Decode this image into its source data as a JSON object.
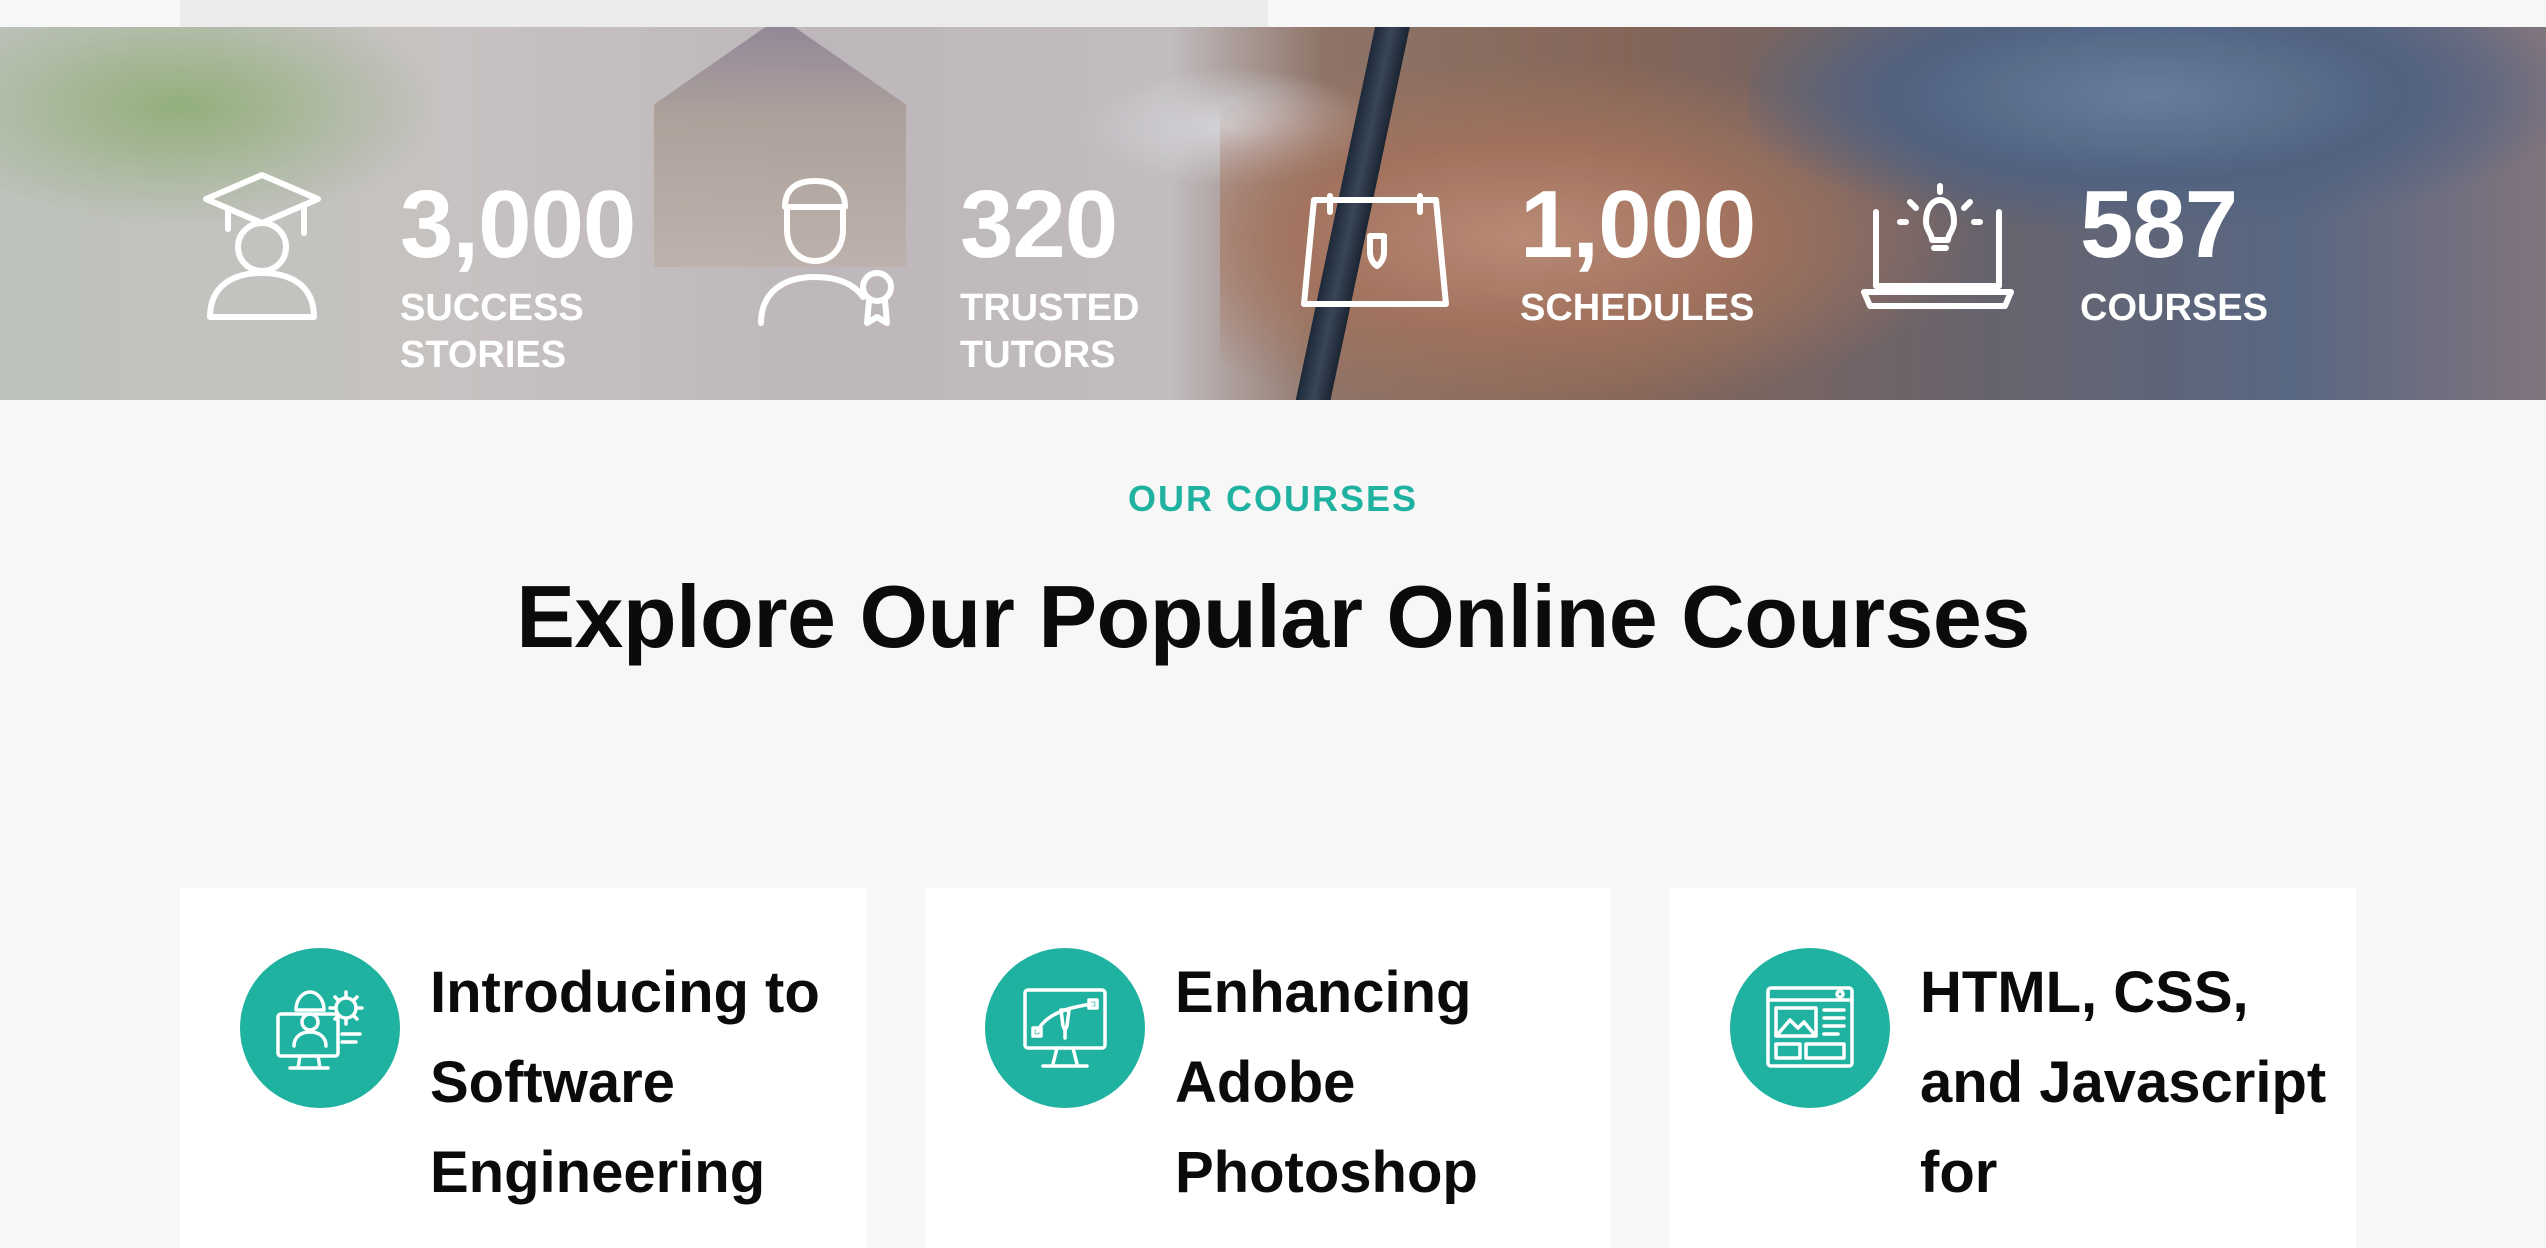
{
  "stats": [
    {
      "value": "3,000",
      "label": "SUCCESS STORIES",
      "icon": "graduate-icon"
    },
    {
      "value": "320",
      "label": "TRUSTED TUTORS",
      "icon": "tutor-icon"
    },
    {
      "value": "1,000",
      "label": "SCHEDULES",
      "icon": "calendar-icon"
    },
    {
      "value": "587",
      "label": "COURSES",
      "icon": "laptop-idea-icon"
    }
  ],
  "section": {
    "eyebrow": "OUR COURSES",
    "title": "Explore Our Popular Online Courses"
  },
  "courses": [
    {
      "title": "Introducing to Software Engineering",
      "icon": "engineer-monitor-icon"
    },
    {
      "title": "Enhancing Adobe Photoshop",
      "icon": "design-monitor-icon"
    },
    {
      "title": "HTML, CSS, and Javascript for",
      "icon": "web-layout-icon"
    }
  ],
  "colors": {
    "accent": "#20b2a0",
    "heading": "#0b0b0b",
    "page_bg": "#f7f7f7"
  }
}
